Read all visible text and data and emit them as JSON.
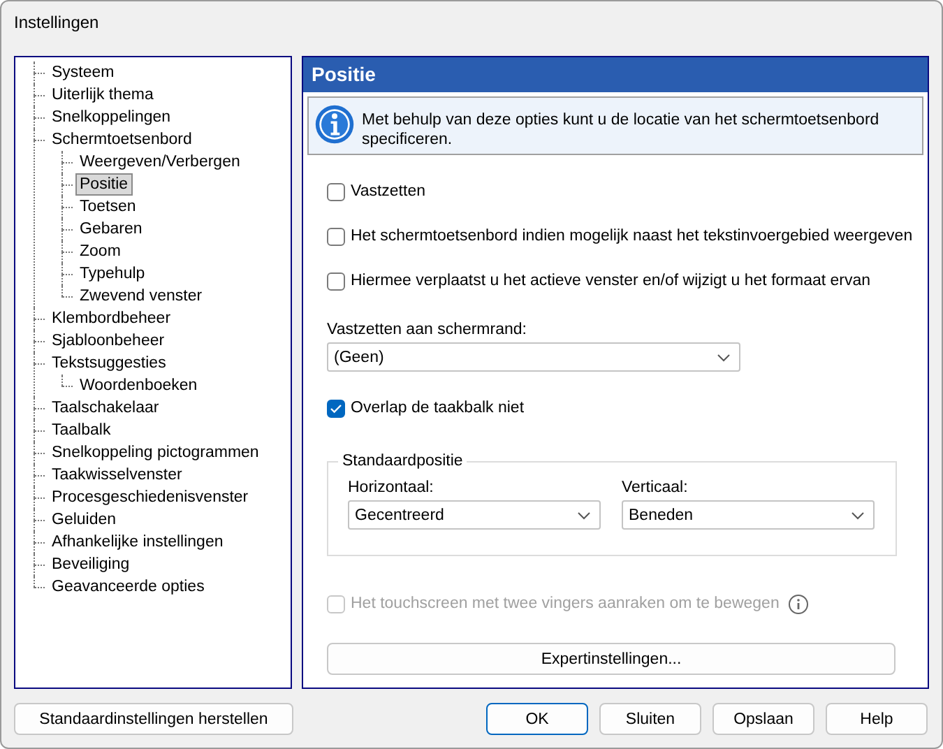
{
  "window": {
    "title": "Instellingen"
  },
  "tree": [
    {
      "label": "Systeem",
      "selected": false
    },
    {
      "label": "Uiterlijk thema",
      "selected": false
    },
    {
      "label": "Snelkoppelingen",
      "selected": false
    },
    {
      "label": "Schermtoetsenbord",
      "selected": false,
      "children": [
        {
          "label": "Weergeven/Verbergen",
          "selected": false
        },
        {
          "label": "Positie",
          "selected": true
        },
        {
          "label": "Toetsen",
          "selected": false
        },
        {
          "label": "Gebaren",
          "selected": false
        },
        {
          "label": "Zoom",
          "selected": false
        },
        {
          "label": "Typehulp",
          "selected": false
        },
        {
          "label": "Zwevend venster",
          "selected": false
        }
      ]
    },
    {
      "label": "Klembordbeheer",
      "selected": false
    },
    {
      "label": "Sjabloonbeheer",
      "selected": false
    },
    {
      "label": "Tekstsuggesties",
      "selected": false,
      "children": [
        {
          "label": "Woordenboeken",
          "selected": false
        }
      ]
    },
    {
      "label": "Taalschakelaar",
      "selected": false
    },
    {
      "label": "Taalbalk",
      "selected": false
    },
    {
      "label": "Snelkoppeling pictogrammen",
      "selected": false
    },
    {
      "label": "Taakwisselvenster",
      "selected": false
    },
    {
      "label": "Procesgeschiedenisvenster",
      "selected": false
    },
    {
      "label": "Geluiden",
      "selected": false
    },
    {
      "label": "Afhankelijke instellingen",
      "selected": false
    },
    {
      "label": "Beveiliging",
      "selected": false
    },
    {
      "label": "Geavanceerde opties",
      "selected": false
    }
  ],
  "panel": {
    "title": "Positie",
    "info": "Met behulp van deze opties kunt u de locatie van het schermtoetsenbord specificeren.",
    "controls": [
      {
        "kind": "checkbox",
        "label": "Vastzetten",
        "checked": false,
        "disabled": false
      },
      {
        "kind": "checkbox",
        "label": "Het schermtoetsenbord indien mogelijk naast het tekstinvoergebied weergeven",
        "checked": false,
        "disabled": false
      },
      {
        "kind": "checkbox",
        "label": "Hiermee verplaatst u het actieve venster en/of wijzigt u het formaat ervan",
        "checked": false,
        "disabled": false
      },
      {
        "kind": "dropdown",
        "label": "Vastzetten aan schermrand:",
        "value": "(Geen)"
      },
      {
        "kind": "checkbox",
        "label": "Overlap de taakbalk niet",
        "checked": true,
        "disabled": false
      },
      {
        "kind": "group",
        "title": "Standaardpositie",
        "fields": [
          {
            "label": "Horizontaal:",
            "value": "Gecentreerd"
          },
          {
            "label": "Verticaal:",
            "value": "Beneden"
          }
        ]
      },
      {
        "kind": "hint-checkbox",
        "label": "Het touchscreen met twee vingers aanraken om te bewegen",
        "checked": false,
        "disabled": true
      },
      {
        "kind": "button",
        "label": "Expertinstellingen..."
      }
    ]
  },
  "reset_button": "Standaardinstellingen herstellen",
  "buttons": [
    {
      "label": "OK",
      "default": true
    },
    {
      "label": "Sluiten",
      "default": false
    },
    {
      "label": "Opslaan",
      "default": false
    },
    {
      "label": "Help",
      "default": false
    }
  ]
}
